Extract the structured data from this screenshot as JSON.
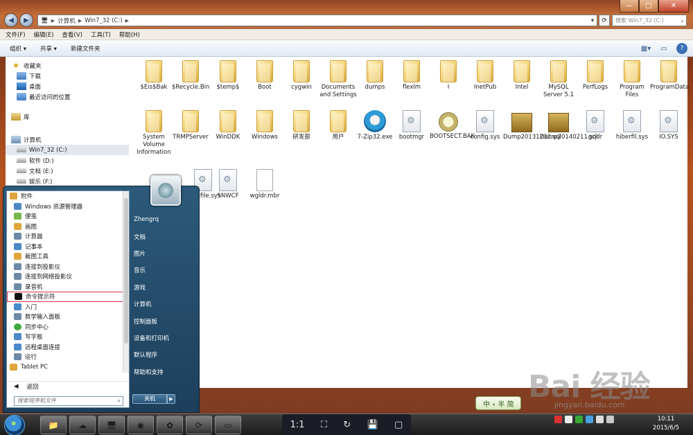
{
  "window": {
    "address": [
      "计算机",
      "Win7_32 (C:)"
    ],
    "search_placeholder": "搜索 Win7_32 (C:)",
    "controls": {
      "minimize": "—",
      "maximize": "□",
      "close": "✕"
    }
  },
  "menubar": [
    "文件(F)",
    "编辑(E)",
    "查看(V)",
    "工具(T)",
    "帮助(H)"
  ],
  "toolbar": {
    "organize": "组织 ▾",
    "share": "共享 ▾",
    "new_folder": "新建文件夹"
  },
  "navpane": {
    "favorites": "收藏夹",
    "downloads": "下载",
    "desktop": "桌面",
    "recent": "最近访问的位置",
    "libraries": "库",
    "computer": "计算机",
    "drives": [
      "Win7_32 (C:)",
      "软件 (D:)",
      "文档 (E:)",
      "娱乐 (F:)"
    ]
  },
  "files": [
    "$Eis$Bak",
    "$Recycle.Bin",
    "$temp$",
    "Boot",
    "cygwin",
    "Documents and Settings",
    "dumps",
    "flexlm",
    "I",
    "InetPub",
    "Intel",
    "MySQL Server 5.1",
    "PerfLogs",
    "Program Files",
    "ProgramData",
    "System Volume Information",
    "TRMPServer",
    "WinDDK",
    "Windows",
    "研发部",
    "用户",
    "7-Zip32.exe",
    "bootmgr",
    "BOOTSECT.BAK",
    "config.sys",
    "Dump20131231.sql",
    "Dump20140211.sql",
    "grldr",
    "hiberfil.sys",
    "IO.SYS",
    "pagefile.sys",
    "SNWCF",
    "wgldr.mbr"
  ],
  "startmenu": {
    "programs": [
      "附件",
      "Windows 资源管理器",
      "便笺",
      "画图",
      "计算器",
      "记事本",
      "截图工具",
      "连接到投影仪",
      "连接到网络投影仪",
      "录音机",
      "命令提示符",
      "入门",
      "数学输入面板",
      "同步中心",
      "写字板",
      "远程桌面连接",
      "运行",
      "Tablet PC"
    ],
    "back": "返回",
    "search_placeholder": "搜索程序和文件",
    "right": [
      "Zhengrq",
      "文档",
      "图片",
      "音乐",
      "游戏",
      "计算机",
      "控制面板",
      "设备和打印机",
      "默认程序",
      "帮助和支持"
    ],
    "shutdown": "关机"
  },
  "taskbar": {
    "playbar": [
      "1:1",
      "⛶",
      "↻",
      "💾",
      "▢"
    ],
    "time": "10:11",
    "date": "2015/6/5"
  },
  "ime": "中 ∘ 半 简",
  "watermark": {
    "brand": "Bai 经验",
    "url": "jingyan.baidu.com"
  }
}
